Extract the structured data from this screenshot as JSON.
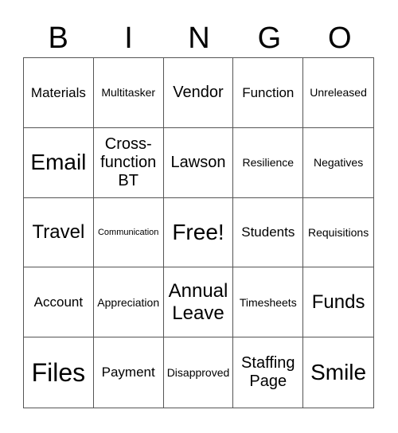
{
  "header": {
    "letters": [
      "B",
      "I",
      "N",
      "G",
      "O"
    ]
  },
  "cells": [
    [
      "Materials",
      "Multitasker",
      "Vendor",
      "Function",
      "Unreleased"
    ],
    [
      "Email",
      "Cross-function BT",
      "Lawson",
      "Resilience",
      "Negatives"
    ],
    [
      "Travel",
      "Communication",
      "Free!",
      "Students",
      "Requisitions"
    ],
    [
      "Account",
      "Appreciation",
      "Annual Leave",
      "Timesheets",
      "Funds"
    ],
    [
      "Files",
      "Payment",
      "Disapproved",
      "Staffing Page",
      "Smile"
    ]
  ]
}
